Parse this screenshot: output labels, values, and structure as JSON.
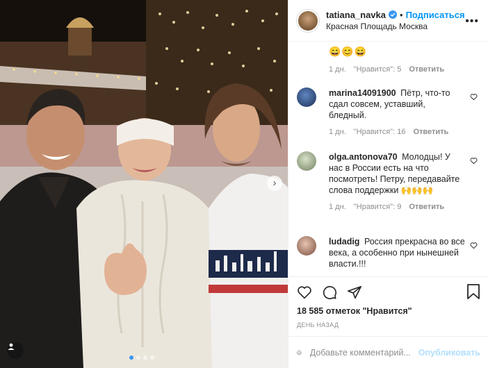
{
  "post": {
    "username": "tatiana_navka",
    "separator": "•",
    "follow_label": "Подписаться",
    "location": "Красная Площадь Москва",
    "more_icon": "more-horizontal-icon",
    "verified_icon": "verified-badge-icon"
  },
  "photo": {
    "next_icon": "chevron-right-icon",
    "tag_icon": "user-tag-icon",
    "carousel_count": 4,
    "carousel_active": 1
  },
  "comments": {
    "prev_tail": {
      "emoji": "😄😊😄",
      "time": "1 дн.",
      "likes": "\"Нравится\": 5",
      "reply": "Ответить"
    },
    "items": [
      {
        "user": "marina14091900",
        "text": "Пётр, что-то сдал совсем, уставший, бледный.",
        "time": "1 дн.",
        "likes": "\"Нравится\": 16",
        "reply": "Ответить",
        "avatar_color": "#2f4f7f"
      },
      {
        "user": "olga.antonova70",
        "text": "Молодцы! У нас в России есть на что посмотреть! Петру, передавайте слова поддержки 🙌🙌🙌",
        "time": "1 дн.",
        "likes": "\"Нравится\": 9",
        "reply": "Ответить",
        "avatar_color": "#9aaa8a"
      },
      {
        "user": "ludadig",
        "text": "Россия прекрасна во все века, а особенно при нынешней власти.!!!",
        "time": "",
        "likes": "",
        "reply": "",
        "avatar_color": "#a07a6a"
      }
    ]
  },
  "actions": {
    "icons": [
      "heart-icon",
      "comment-icon",
      "share-icon",
      "bookmark-icon"
    ],
    "likes_text": "18 585 отметок \"Нравится\"",
    "date": "ДЕНЬ НАЗАД"
  },
  "add_comment": {
    "placeholder": "Добавьте комментарий...",
    "publish_label": "Опубликовать"
  },
  "colors": {
    "link_blue": "#0095f6",
    "publish_disabled": "#b2dffc",
    "muted": "#8e8e8e"
  }
}
